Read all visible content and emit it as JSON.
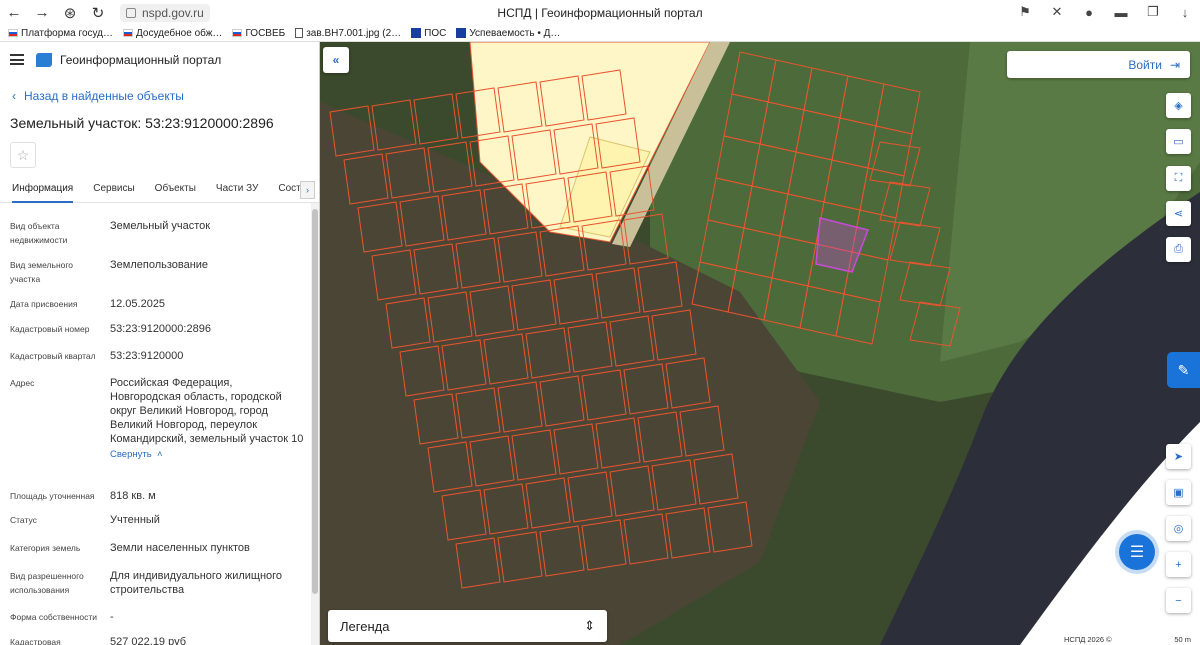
{
  "browser": {
    "url": "nspd.gov.ru",
    "tab_title": "НСПД | Геоинформационный портал",
    "bookmarks": [
      {
        "label": "Платформа госуд…",
        "icon": "flag-icon"
      },
      {
        "label": "Досудебное обж…",
        "icon": "flag-icon"
      },
      {
        "label": "ГОСВЕБ",
        "icon": "flag-icon"
      },
      {
        "label": "зав.ВН7.001.jpg (2…",
        "icon": "document-icon"
      },
      {
        "label": "ПОС",
        "icon": "bookmark-icon"
      },
      {
        "label": "Успеваемость • Д…",
        "icon": "bookmark-icon"
      }
    ]
  },
  "header": {
    "portal_title": "Геоинформационный портал"
  },
  "panel": {
    "back_link": "Назад в найденные объекты",
    "title": "Земельный участок: 53:23:9120000:2896",
    "tabs": [
      "Информация",
      "Сервисы",
      "Объекты",
      "Части ЗУ",
      "Состав"
    ],
    "active_tab": "Информация",
    "attributes": [
      {
        "label": "Вид объекта недвижимости",
        "value": "Земельный участок"
      },
      {
        "label": "Вид земельного участка",
        "value": "Землепользование"
      },
      {
        "label": "Дата присвоения",
        "value": "12.05.2025"
      },
      {
        "label": "Кадастровый номер",
        "value": "53:23:9120000:2896"
      },
      {
        "label": "Кадастровый квартал",
        "value": "53:23:9120000"
      },
      {
        "label": "Адрес",
        "value": "Российская Федерация, Новгородская область, городской округ Великий Новгород, город Великий Новгород, переулок Командирский, земельный участок 10"
      },
      {
        "label": "Площадь уточненная",
        "value": "818 кв. м"
      },
      {
        "label": "Статус",
        "value": "Учтенный"
      },
      {
        "label": "Категория земель",
        "value": "Земли населенных пунктов"
      },
      {
        "label": "Вид разрешенного использования",
        "value": "Для индивидуального жилищного строительства"
      },
      {
        "label": "Форма собственности",
        "value": "-"
      },
      {
        "label": "Кадастровая",
        "value": "527 022,19 руб"
      }
    ],
    "collapse_link": "Свернуть"
  },
  "map": {
    "login_label": "Войти",
    "legend_label": "Легенда",
    "copyright": "НСПД 2026 ©",
    "scale": "50 m",
    "parcel_color": "#e8552e",
    "selected_color": "#c84bd8",
    "water_color": "#2c2f3a"
  }
}
